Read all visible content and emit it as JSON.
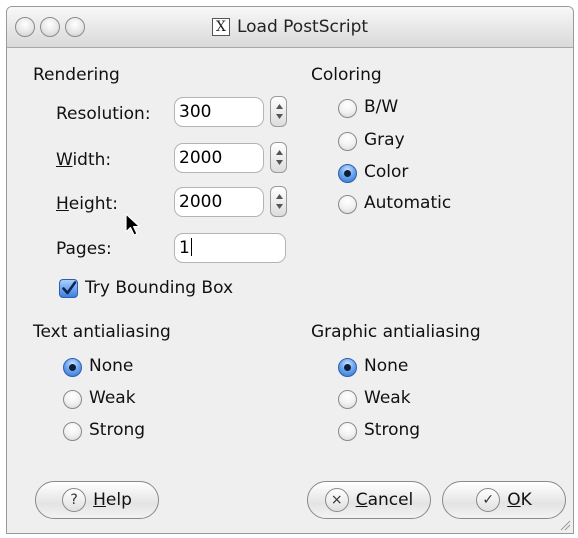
{
  "window": {
    "title": "Load PostScript",
    "title_icon": "x11-icon"
  },
  "rendering": {
    "label": "Rendering",
    "resolution": {
      "label": "Resolution:",
      "value": "300"
    },
    "width": {
      "label_u": "W",
      "label_rest": "idth:",
      "value": "2000"
    },
    "height": {
      "label_u": "H",
      "label_rest": "eight:",
      "value": "2000"
    },
    "pages": {
      "label": "Pages:",
      "value": "1"
    },
    "bounding_box": {
      "label": "Try Bounding Box",
      "checked": true
    }
  },
  "coloring": {
    "label": "Coloring",
    "options": [
      "B/W",
      "Gray",
      "Color",
      "Automatic"
    ],
    "selected": "Color"
  },
  "text_antialiasing": {
    "label": "Text antialiasing",
    "options": [
      "None",
      "Weak",
      "Strong"
    ],
    "selected": "None"
  },
  "graphic_antialiasing": {
    "label": "Graphic antialiasing",
    "options": [
      "None",
      "Weak",
      "Strong"
    ],
    "selected": "None"
  },
  "buttons": {
    "help": {
      "u": "H",
      "rest": "elp",
      "icon": "?"
    },
    "cancel": {
      "u": "C",
      "rest": "ancel",
      "icon": "×"
    },
    "ok": {
      "u": "O",
      "rest": "K",
      "icon": "✓"
    }
  },
  "colors": {
    "window_bg": "#efefef",
    "accent": "#2d6fd0"
  }
}
